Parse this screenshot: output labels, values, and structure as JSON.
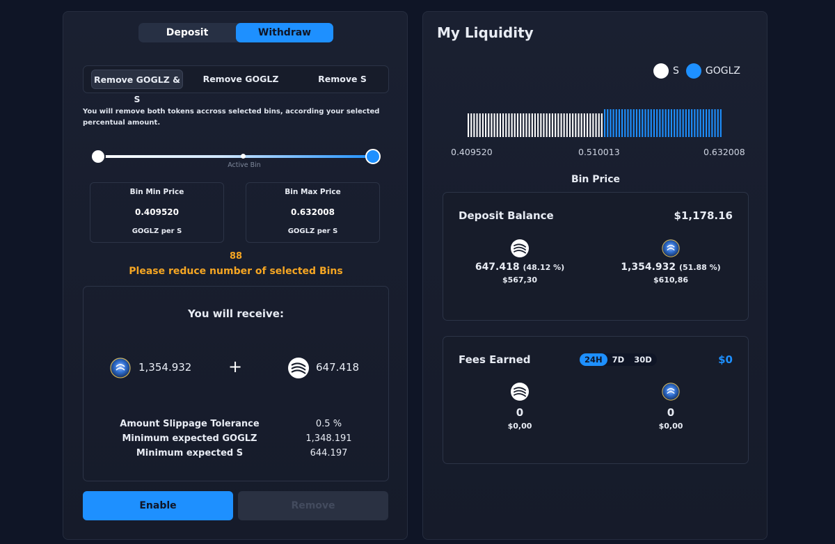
{
  "withdraw_panel": {
    "mode_tabs": {
      "deposit": "Deposit",
      "withdraw": "Withdraw"
    },
    "remove_tabs": [
      "Remove GOGLZ & S",
      "Remove GOGLZ",
      "Remove S"
    ],
    "description": "You will remove both tokens accross selected bins, according your selected percentual amount.",
    "slider": {
      "active_label": "Active Bin"
    },
    "bin_min": {
      "title": "Bin Min Price",
      "value": "0.409520",
      "unit": "GOGLZ per S"
    },
    "bin_max": {
      "title": "Bin Max Price",
      "value": "0.632008",
      "unit": "GOGLZ per S"
    },
    "warning_count": "88",
    "warning_text": "Please reduce number of selected Bins",
    "receive": {
      "title": "You will receive:",
      "goglz_amount": "1,354.932",
      "plus": "+",
      "s_amount": "647.418",
      "details": [
        {
          "label": "Amount Slippage Tolerance",
          "value": "0.5 %"
        },
        {
          "label": "Minimum expected GOGLZ",
          "value": "1,348.191"
        },
        {
          "label": "Minimum expected S",
          "value": "644.197"
        }
      ]
    },
    "buttons": {
      "enable": "Enable",
      "remove": "Remove"
    }
  },
  "liquidity_panel": {
    "title": "My Liquidity",
    "legend": [
      {
        "label": "S",
        "color": "#ffffff"
      },
      {
        "label": "GOGLZ",
        "color": "#1e90ff"
      }
    ],
    "bin_prices": [
      "0.409520",
      "0.510013",
      "0.632008"
    ],
    "bin_price_label": "Bin Price",
    "deposit_balance": {
      "title": "Deposit Balance",
      "total": "$1,178.16",
      "s": {
        "amount": "647.418",
        "pct": "(48.12 %)",
        "usd": "$567,30"
      },
      "goglz": {
        "amount": "1,354.932",
        "pct": "(51.88 %)",
        "usd": "$610,86"
      }
    },
    "fees": {
      "title": "Fees Earned",
      "periods": [
        "24H",
        "7D",
        "30D"
      ],
      "active_period": "24H",
      "total": "$0",
      "s": {
        "amount": "0",
        "usd": "$0,00"
      },
      "goglz": {
        "amount": "0",
        "usd": "$0,00"
      }
    }
  },
  "colors": {
    "accent": "#1e90ff",
    "warning": "#f5a623",
    "background": "#0f1526"
  }
}
